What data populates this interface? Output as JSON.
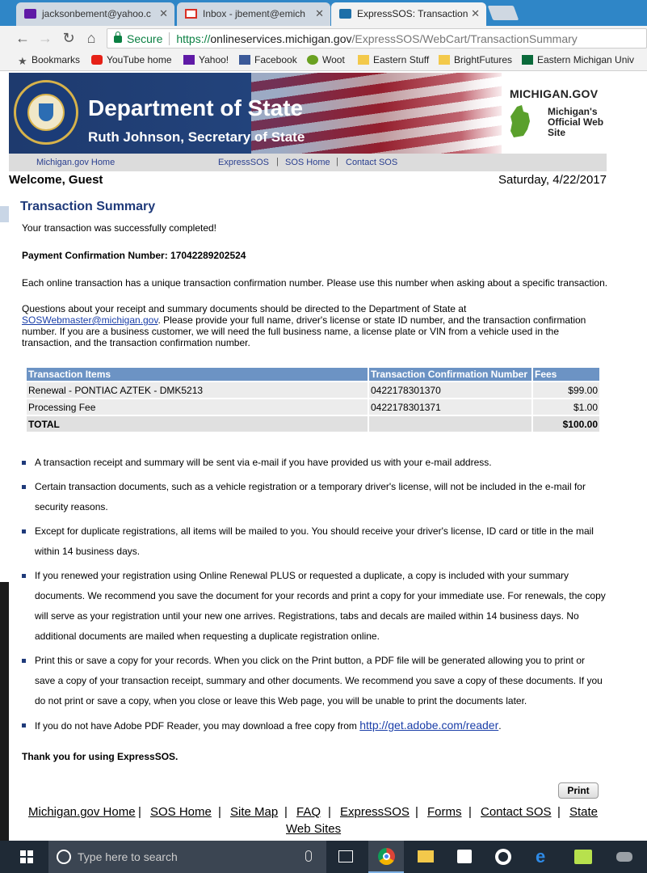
{
  "browser": {
    "tabs": [
      {
        "title": "jacksonbement@yahoo.c",
        "close": "✕"
      },
      {
        "title": "Inbox - jbement@emich",
        "close": "✕"
      },
      {
        "title": "ExpressSOS: Transaction",
        "close": "✕"
      }
    ],
    "secure_label": "Secure",
    "url_scheme": "https://",
    "url_host": "onlineservices.michigan.gov",
    "url_path": "/ExpressSOS/WebCart/TransactionSummary",
    "bookmarks": [
      "Bookmarks",
      "YouTube home",
      "Yahoo!",
      "Facebook",
      "Woot",
      "Eastern Stuff",
      "BrightFutures",
      "Eastern Michigan Univ"
    ]
  },
  "header": {
    "title": "Department of State",
    "subtitle": "Ruth Johnson, Secretary of State",
    "mi_gov": "MICHIGAN.GOV",
    "mi_tagline": "Michigan's Official Web Site",
    "seal_text": "STATE OF MICHIGAN · SECRETARY OF STATE"
  },
  "subnav": {
    "michigan_gov_home": "Michigan.gov Home",
    "express_sos": "ExpressSOS",
    "sos_home": "SOS Home",
    "contact_sos": "Contact SOS",
    "pipe": "|"
  },
  "welcome": "Welcome, Guest",
  "date": "Saturday, 4/22/2017",
  "summary": {
    "heading": "Transaction Summary",
    "success": "Your transaction was successfully completed!",
    "confirmation_label": "Payment Confirmation Number:",
    "confirmation_number": "17042289202524",
    "unique_note": "Each online transaction has a unique transaction confirmation number. Please use this number when asking about a specific transaction.",
    "questions_prefix": "Questions about your receipt and summary documents should be directed to the Department of State at",
    "email": "SOSWebmaster@michigan.gov",
    "questions_suffix": ". Please provide your full name, driver's license or state ID number, and the transaction confirmation number. If you are a business customer, we will need the full business name, a license plate or VIN from a vehicle used in the transaction, and the transaction confirmation number."
  },
  "table": {
    "headers": [
      "Transaction Items",
      "Transaction Confirmation Number",
      "Fees"
    ],
    "rows": [
      {
        "item": "Renewal - PONTIAC AZTEK - DMK5213",
        "number": "0422178301370",
        "fee": "$99.00"
      },
      {
        "item": "Processing Fee",
        "number": "0422178301371",
        "fee": "$1.00"
      }
    ],
    "total_label": "TOTAL",
    "total_fee": "$100.00"
  },
  "bullets": [
    "A transaction receipt and summary will be sent via e-mail if you have provided us with your e-mail address.",
    "Certain transaction documents, such as a vehicle registration or a temporary driver's license, will not be included in the e-mail for security reasons.",
    "Except for duplicate registrations, all items will be mailed to you. You should receive your driver's license, ID card or title in the mail within 14 business days.",
    "If you renewed your registration using Online Renewal PLUS or requested a duplicate, a copy is included with your summary documents. We recommend you save the document for your records and print a copy for your immediate use. For renewals, the copy will serve as your registration until your new one arrives. Registrations, tabs and decals are mailed within 14 business days. No additional documents are mailed when requesting a duplicate registration online.",
    "Print this or save a copy for your records. When you click on the Print button, a PDF file will be generated allowing you to print or save a copy of your transaction receipt, summary and other documents. We recommend you save a copy of these documents. If you do not print or save a copy, when you close or leave this Web page, you will be unable to print the documents later."
  ],
  "adobe": {
    "prefix": "If you do not have Adobe PDF Reader, you may download a free copy from",
    "link": "http://get.adobe.com/reader",
    "suffix": "."
  },
  "thanks": "Thank you for using ExpressSOS.",
  "print_label": "Print",
  "footer": {
    "links": [
      "Michigan.gov Home",
      "SOS Home",
      "Site Map",
      "FAQ",
      "ExpressSOS",
      "Forms",
      "Contact SOS",
      "State",
      "Web Sites"
    ],
    "pipe": "|"
  },
  "taskbar": {
    "search_placeholder": "Type here to search"
  }
}
